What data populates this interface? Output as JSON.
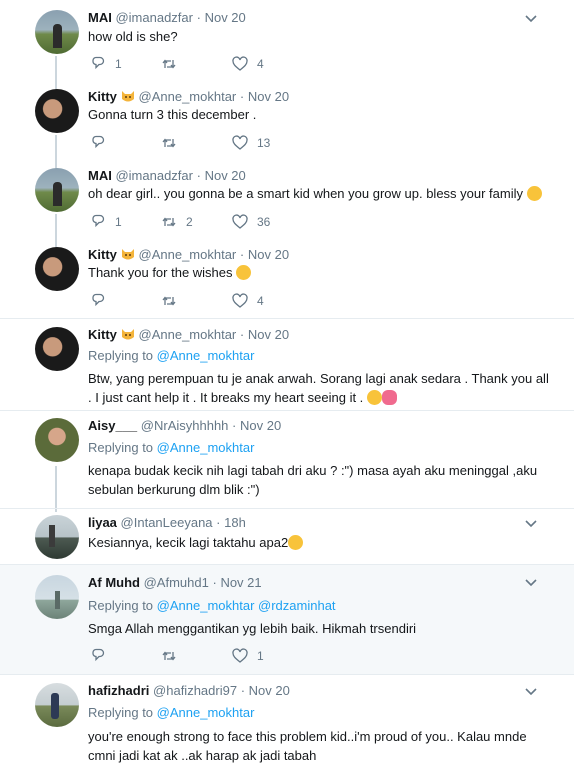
{
  "tweets": [
    {
      "name": "MAI",
      "handle": "@imanadzfar",
      "time": "Nov 20",
      "text": "how old is she?",
      "reply": "1",
      "retweet": "",
      "like": "4"
    },
    {
      "name": "Kitty",
      "handle": "@Anne_mokhtar",
      "time": "Nov 20",
      "text": "Gonna turn 3 this december .",
      "reply": "",
      "retweet": "",
      "like": "13"
    },
    {
      "name": "MAI",
      "handle": "@imanadzfar",
      "time": "Nov 20",
      "text": "oh dear girl.. you gonna be a smart kid when you grow up. bless your family",
      "reply": "1",
      "retweet": "2",
      "like": "36"
    },
    {
      "name": "Kitty",
      "handle": "@Anne_mokhtar",
      "time": "Nov 20",
      "text": "Thank you for the wishes",
      "reply": "",
      "retweet": "",
      "like": "4"
    },
    {
      "name": "Kitty",
      "handle": "@Anne_mokhtar",
      "time": "Nov 20",
      "replying_label": "Replying to",
      "replying_to": "@Anne_mokhtar",
      "text": "Btw, yang perempuan tu je anak arwah. Sorang lagi anak sedara . Thank you all . I just cant help it . It breaks my heart seeing it ."
    },
    {
      "name": "Aisy___",
      "handle": "@NrAisyhhhhh",
      "time": "Nov 20",
      "replying_label": "Replying to",
      "replying_to": "@Anne_mokhtar",
      "text": "kenapa budak kecik nih lagi tabah dri aku ? :\") masa ayah aku meninggal ,aku sebulan berkurung dlm blik :\")"
    },
    {
      "name": "liyaa",
      "handle": "@IntanLeeyana",
      "time": "18h",
      "text": "Kesiannya, kecik lagi taktahu apa2"
    },
    {
      "name": "Af Muhd",
      "handle": "@Afmuhd1",
      "time": "Nov 21",
      "replying_label": "Replying to",
      "replying_to": "@Anne_mokhtar @rdzaminhat",
      "text": "Smga Allah menggantikan yg lebih baik.  Hikmah trsendiri",
      "reply": "",
      "retweet": "",
      "like": "1"
    },
    {
      "name": "hafizhadri",
      "handle": "@hafizhadri97",
      "time": "Nov 20",
      "replying_label": "Replying to",
      "replying_to": "@Anne_mokhtar",
      "text": "you're enough strong to face this problem kid..i'm proud of you.. Kalau mnde cmni jadi kat ak ..ak harap ak jadi tabah"
    }
  ],
  "dot": "·",
  "icons": [
    "chevron-down-icon",
    "reply-icon",
    "retweet-icon",
    "like-icon",
    "cat-emoji-icon",
    "emoji-icon"
  ],
  "colors": {
    "link": "#1da1f2",
    "muted": "#657786",
    "text": "#14171a",
    "highlight_bg": "#f5f8fa",
    "separator": "#e6ecf0",
    "thread_line": "#ccd6dd"
  }
}
